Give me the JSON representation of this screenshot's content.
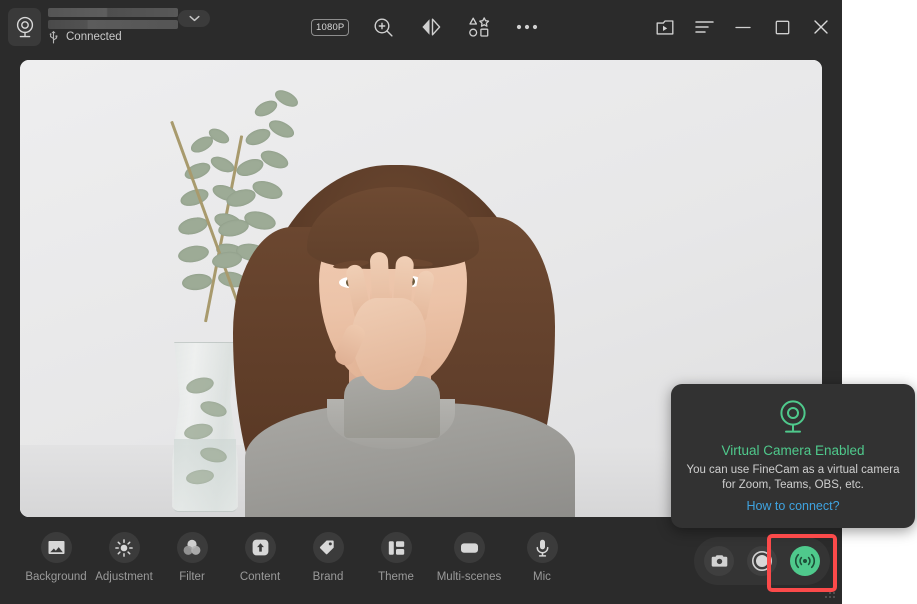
{
  "app": {
    "accent_color": "#29b6d8",
    "brand_green": "#4fc98c",
    "link_blue": "#3fa3e0",
    "highlight_red": "#fb4a4a"
  },
  "titlebar": {
    "camera_icon": "webcam-icon",
    "device_name_redacted": true,
    "dropdown_icon": "chevron-down-icon",
    "connection": {
      "icon": "usb-icon",
      "label": "Connected"
    },
    "tools": [
      {
        "name": "resolution-badge",
        "label": "1080P",
        "icon": "resolution-badge"
      },
      {
        "name": "zoom-tool",
        "label": "Zoom",
        "icon": "magnifier-plus-icon"
      },
      {
        "name": "mirror-tool",
        "label": "Mirror",
        "icon": "mirror-flip-icon"
      },
      {
        "name": "stickers-tool",
        "label": "Shapes",
        "icon": "shapes-icon"
      },
      {
        "name": "more-tool",
        "label": "More",
        "icon": "ellipsis-icon"
      }
    ],
    "window_controls": [
      {
        "name": "media-library-button",
        "label": "Media Library",
        "icon": "video-folder-icon"
      },
      {
        "name": "menu-button",
        "label": "Menu",
        "icon": "hamburger-menu-icon"
      },
      {
        "name": "minimize-button",
        "label": "Minimize",
        "icon": "minimize-icon"
      },
      {
        "name": "maximize-button",
        "label": "Maximize",
        "icon": "maximize-icon"
      },
      {
        "name": "close-button",
        "label": "Close",
        "icon": "close-icon"
      }
    ]
  },
  "preview": {
    "description": "Live webcam preview: smiling woman with long brown hair in a gray hoodie waving, glass vase with eucalyptus branches on a white table against a light gray wall"
  },
  "bottom_toolbar": {
    "features": [
      {
        "label": "Background",
        "icon": "image-icon"
      },
      {
        "label": "Adjustment",
        "icon": "brightness-sun-icon"
      },
      {
        "label": "Filter",
        "icon": "color-circles-icon"
      },
      {
        "label": "Content",
        "icon": "upload-arrow-icon"
      },
      {
        "label": "Brand",
        "icon": "tag-icon"
      },
      {
        "label": "Theme",
        "icon": "layout-blocks-icon"
      },
      {
        "label": "Multi-scenes",
        "icon": "scenes-icon"
      },
      {
        "label": "Mic",
        "icon": "microphone-icon"
      }
    ],
    "actions": [
      {
        "name": "snapshot-button",
        "label": "Snapshot",
        "icon": "camera-icon",
        "active": false
      },
      {
        "name": "record-button",
        "label": "Record",
        "icon": "record-circle-icon",
        "active": false
      },
      {
        "name": "virtual-camera-button",
        "label": "Virtual Camera",
        "icon": "broadcast-icon",
        "active": true
      }
    ]
  },
  "notification": {
    "icon": "webcam-outline-icon",
    "title": "Virtual Camera Enabled",
    "description_line1": "You can use FineCam as a virtual camera",
    "description_line2": "for Zoom, Teams, OBS, etc.",
    "link": "How to connect?"
  }
}
